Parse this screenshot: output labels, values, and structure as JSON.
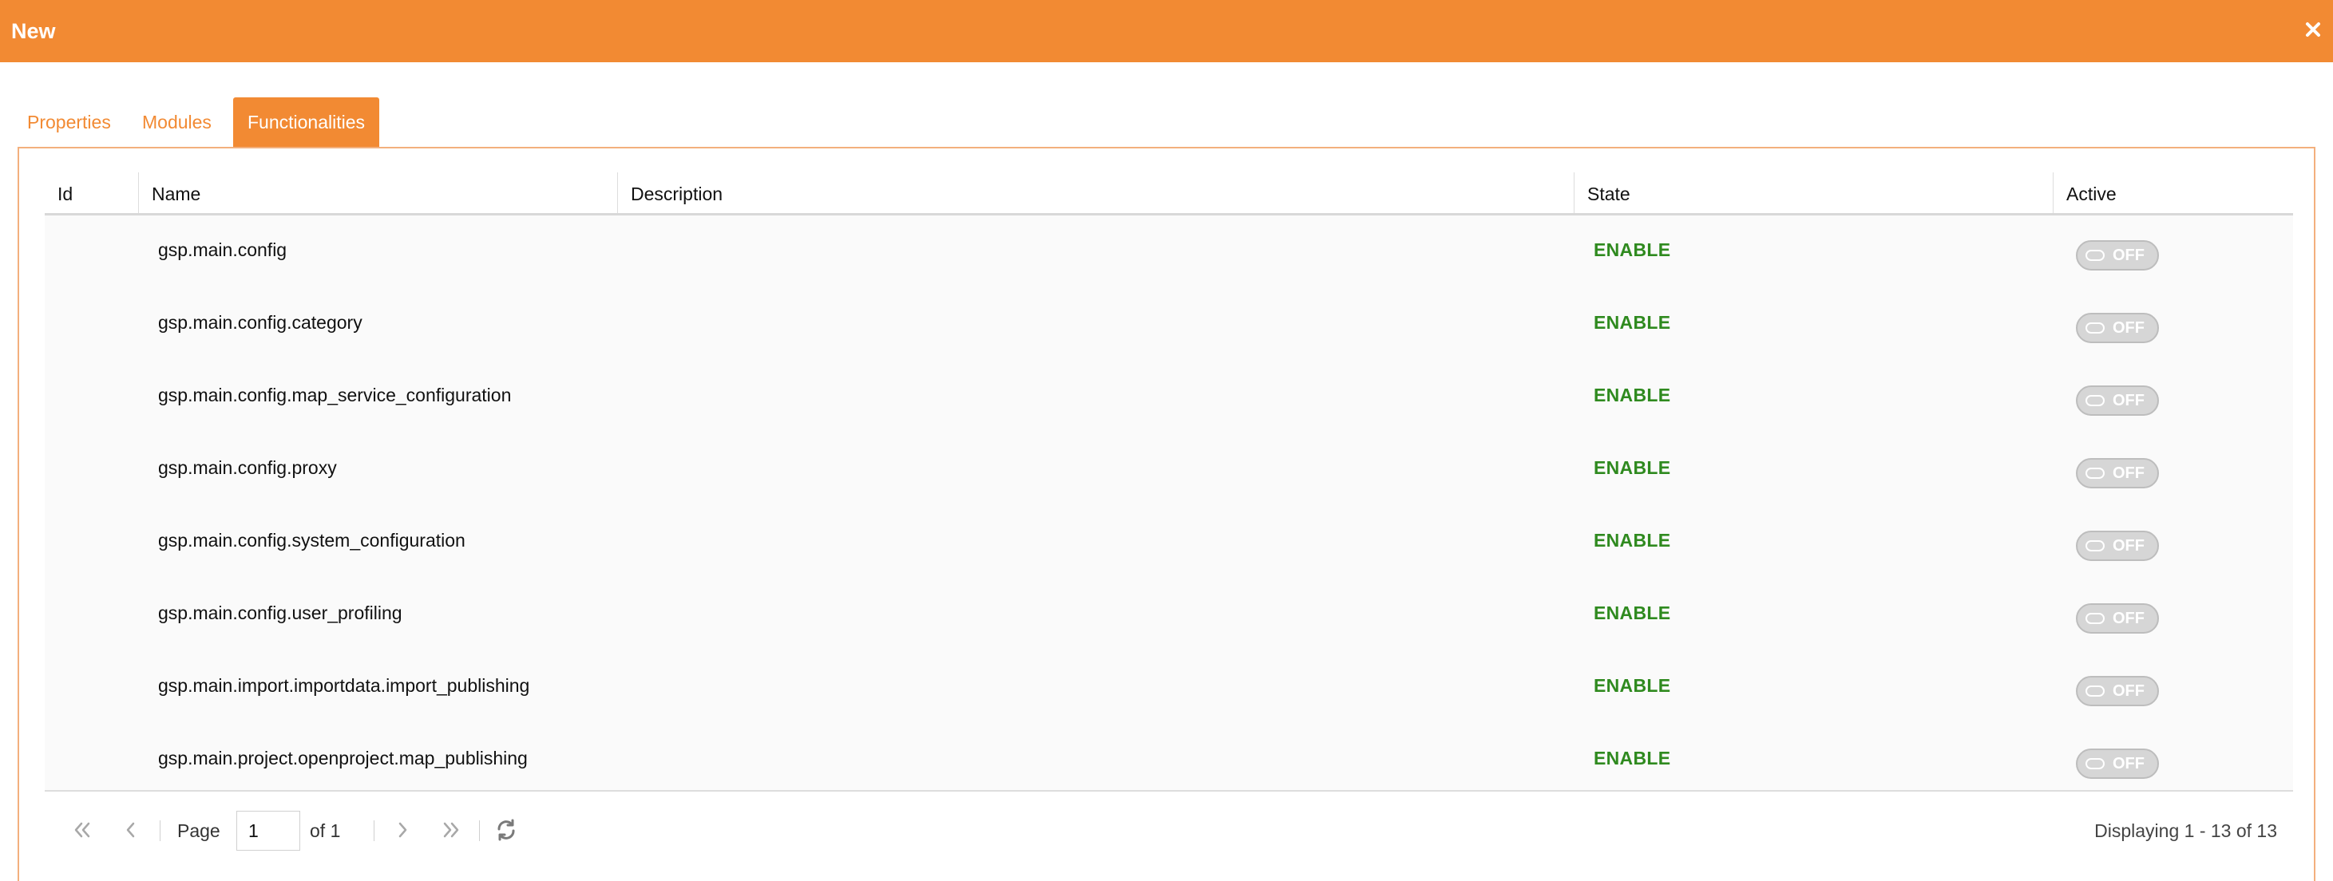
{
  "window": {
    "title": "New",
    "close_icon": "close-icon",
    "accent_color": "#f28a33"
  },
  "tabs": [
    {
      "label": "Properties",
      "active": false
    },
    {
      "label": "Modules",
      "active": false
    },
    {
      "label": "Functionalities",
      "active": true
    }
  ],
  "grid": {
    "columns": [
      "Id",
      "Name",
      "Description",
      "State",
      "Active"
    ],
    "rows": [
      {
        "id": "",
        "name": "gsp.main.config",
        "description": "",
        "state": "ENABLE",
        "active": "OFF"
      },
      {
        "id": "",
        "name": "gsp.main.config.category",
        "description": "",
        "state": "ENABLE",
        "active": "OFF"
      },
      {
        "id": "",
        "name": "gsp.main.config.map_service_configuration",
        "description": "",
        "state": "ENABLE",
        "active": "OFF"
      },
      {
        "id": "",
        "name": "gsp.main.config.proxy",
        "description": "",
        "state": "ENABLE",
        "active": "OFF"
      },
      {
        "id": "",
        "name": "gsp.main.config.system_configuration",
        "description": "",
        "state": "ENABLE",
        "active": "OFF"
      },
      {
        "id": "",
        "name": "gsp.main.config.user_profiling",
        "description": "",
        "state": "ENABLE",
        "active": "OFF"
      },
      {
        "id": "",
        "name": "gsp.main.import.importdata.import_publishing",
        "description": "",
        "state": "ENABLE",
        "active": "OFF"
      },
      {
        "id": "",
        "name": "gsp.main.project.openproject.map_publishing",
        "description": "",
        "state": "ENABLE",
        "active": "OFF"
      }
    ],
    "state_color": "#2f8a1f"
  },
  "pager": {
    "page_label": "Page",
    "page_value": "1",
    "of_label": "of 1",
    "display_text": "Displaying 1 - 13 of 13",
    "icons": [
      "first-page-icon",
      "previous-page-icon",
      "next-page-icon",
      "last-page-icon",
      "refresh-icon"
    ]
  }
}
